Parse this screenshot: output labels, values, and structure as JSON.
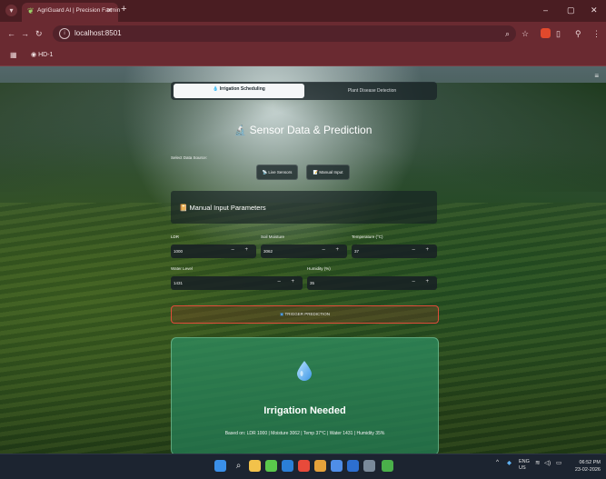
{
  "browser": {
    "tab_title": "AgriGuard AI | Precision Farmin",
    "tab_close": "✕",
    "new_tab": "+",
    "url": "localhost:8501",
    "bookmark": "HD-1",
    "window_controls": [
      "–",
      "▢",
      "✕"
    ]
  },
  "app": {
    "tabs": [
      {
        "label": "Irrigation Scheduling",
        "active": true
      },
      {
        "label": "Plant Disease Detection",
        "active": false
      }
    ],
    "heading": "Sensor Data & Prediction",
    "data_source_label": "Select Data Source:",
    "source_buttons": [
      {
        "label": "Live Sensors"
      },
      {
        "label": "Manual Input"
      }
    ],
    "section_title": "Manual Input Parameters",
    "fields": [
      {
        "label": "LDR",
        "value": "1000"
      },
      {
        "label": "Soil Moisture",
        "value": "3062"
      },
      {
        "label": "Temperature (°C)",
        "value": "37"
      },
      {
        "label": "Water Level",
        "value": "1431"
      },
      {
        "label": "Humidity (%)",
        "value": "35"
      }
    ],
    "stepper": "– +",
    "trigger_label": "TRIGGER PREDICTION",
    "result_title": "Irrigation Needed",
    "result_basis": "Based on: LDR 1000 | Moisture 3062 | Temp 37°C | Water 1431 | Humidity 35%"
  },
  "taskbar": {
    "lang_top": "ENG",
    "lang_bottom": "US",
    "time": "06:52 PM",
    "date": "23-02-2026"
  },
  "colors": {
    "chrome": "#6a2a31",
    "trigger_border": "#e04c3a",
    "result_green": "#2e8c5f"
  }
}
